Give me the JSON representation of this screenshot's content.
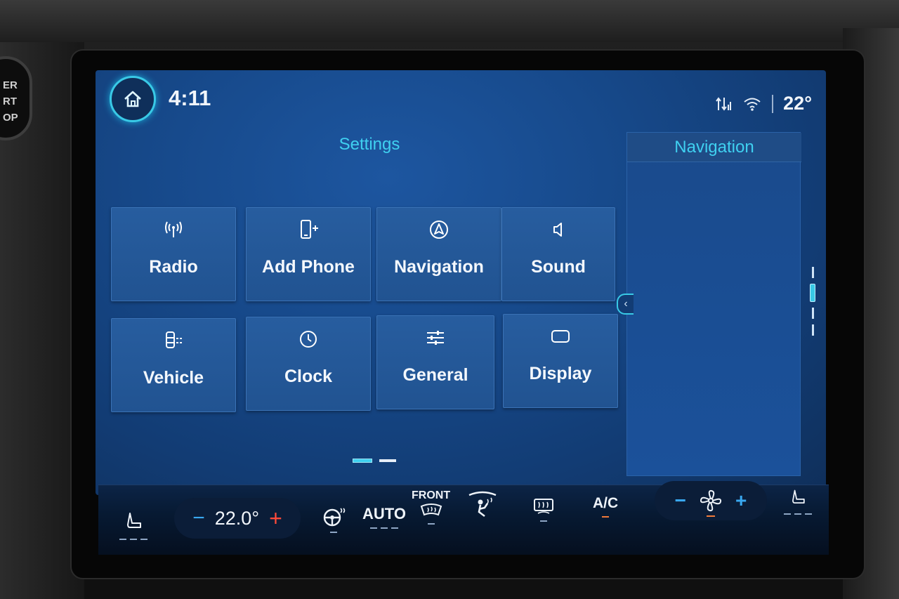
{
  "status": {
    "time": "4:11",
    "outside_temp": "22°",
    "icons": [
      "home-icon",
      "signal-icon",
      "wifi-icon"
    ]
  },
  "settings": {
    "title": "Settings",
    "tiles": [
      {
        "label": "Radio",
        "icon": "radio-antenna-icon"
      },
      {
        "label": "Add Phone",
        "icon": "add-phone-icon"
      },
      {
        "label": "Navigation",
        "icon": "navigation-icon"
      },
      {
        "label": "Sound",
        "icon": "speaker-icon"
      },
      {
        "label": "Vehicle",
        "icon": "vehicle-icon"
      },
      {
        "label": "Clock",
        "icon": "clock-icon"
      },
      {
        "label": "General",
        "icon": "sliders-icon"
      },
      {
        "label": "Display",
        "icon": "display-icon"
      }
    ],
    "page": {
      "current": 1,
      "total": 2
    }
  },
  "side_panel": {
    "title": "Navigation"
  },
  "climate": {
    "driver_temp": "22.0°",
    "auto_label": "AUTO",
    "front_label": "FRONT",
    "ac_label": "A/C",
    "minus": "−",
    "plus": "+"
  },
  "brand_colors": {
    "accent": "#3fd0f0",
    "tile": "#275d9f",
    "background": "#174a8c",
    "heat_indicator": "#f07a3a"
  },
  "hardware": {
    "start_button_text": "ER\nRT\nOP"
  }
}
